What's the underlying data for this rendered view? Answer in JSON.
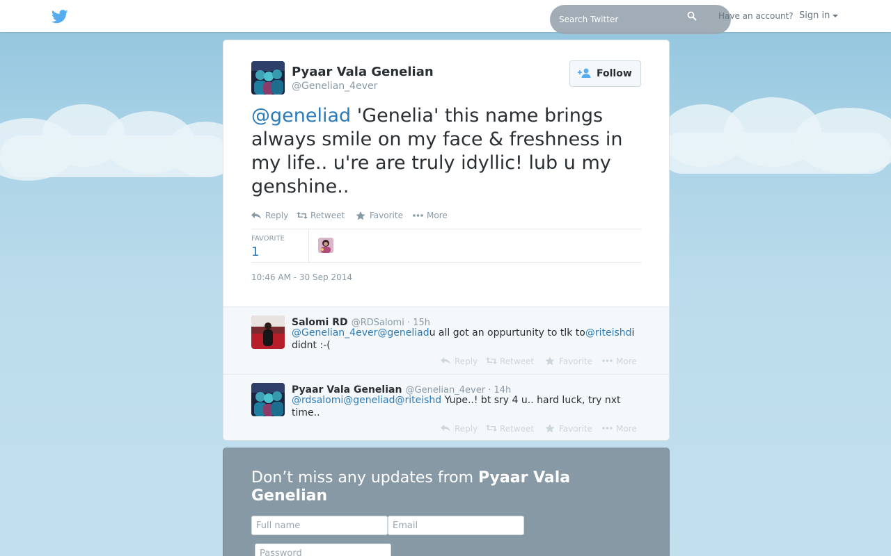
{
  "header": {
    "search_placeholder": "Search Twitter",
    "have_account": "Have an account?",
    "sign_in": "Sign in"
  },
  "tweet": {
    "author_name": "Pyaar Vala Genelian",
    "author_handle": "@Genelian_4ever",
    "follow_label": "Follow",
    "mention": "@geneliad",
    "text": " 'Genelia' this name brings always smile on my face & freshness in my life.. u're are truly idyllic! lub u my genshine..",
    "actions": [
      "Reply",
      "Retweet",
      "Favorite",
      "More"
    ],
    "stat_label": "FAVORITE",
    "stat_value": "1",
    "timestamp": "10:46 AM - 30 Sep 2014"
  },
  "replies": [
    {
      "name": "Salomi RD",
      "meta": "@RDSalomi · 15h",
      "segments": [
        {
          "text": "@Genelian_4ever",
          "mention": true
        },
        {
          "text": "@geneliad",
          "mention": true
        },
        {
          "text": "u all got an oppurtunity to tlk to",
          "mention": false
        },
        {
          "text": "@riteishd",
          "mention": true
        },
        {
          "text": "i didnt :-(",
          "mention": false
        }
      ],
      "actions": [
        "Reply",
        "Retweet",
        "Favorite",
        "More"
      ]
    },
    {
      "name": "Pyaar Vala Genelian",
      "meta": "@Genelian_4ever · 14h",
      "segments": [
        {
          "text": "@rdsalomi",
          "mention": true
        },
        {
          "text": "@geneliad",
          "mention": true
        },
        {
          "text": "@riteishd",
          "mention": true
        },
        {
          "text": " Yupe..! bt sry 4 u.. hard luck, try nxt time..",
          "mention": false
        }
      ],
      "actions": [
        "Reply",
        "Retweet",
        "Favorite",
        "More"
      ]
    }
  ],
  "signup": {
    "heading_prefix": "Don’t miss any updates from ",
    "heading_name": "Pyaar Vala Genelian",
    "fullname_placeholder": "Full name",
    "email_placeholder": "Email",
    "password_placeholder": "Password"
  },
  "colors": {
    "link": "#2b7bb9",
    "brand": "#55acee",
    "text": "#292f33",
    "muted": "#8899a6"
  },
  "icons": [
    "twitter-bird-icon",
    "search-icon",
    "caret-down-icon",
    "follow-person-icon",
    "reply-icon",
    "retweet-icon",
    "star-icon",
    "more-dots-icon"
  ]
}
